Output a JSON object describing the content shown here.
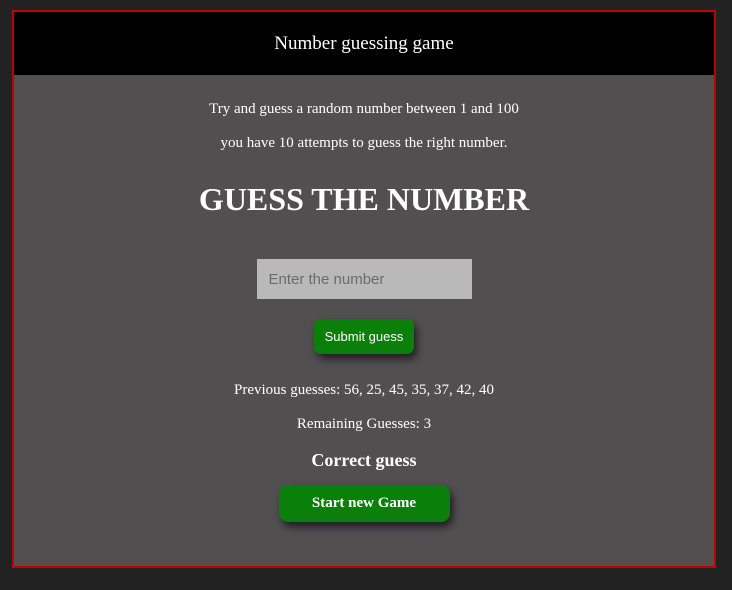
{
  "header": {
    "title": "Number guessing game"
  },
  "intro": {
    "line1": "Try and guess a random number between 1 and 100",
    "line2": "you have 10 attempts to guess the right number."
  },
  "main": {
    "heading": "GUESS THE NUMBER",
    "input": {
      "value": "",
      "placeholder": "Enter the number"
    },
    "submit_label": "Submit guess",
    "previous_guesses": "Previous guesses: 56, 25, 45, 35, 37, 42, 40",
    "remaining_guesses": "Remaining Guesses: 3",
    "result": "Correct guess",
    "new_game_label": "Start new Game"
  },
  "colors": {
    "page_background": "#222222",
    "panel_background": "#514f50",
    "panel_border": "#c00000",
    "header_background": "#000000",
    "button_green": "#0a7f0a",
    "input_background": "#b9b9b9"
  }
}
